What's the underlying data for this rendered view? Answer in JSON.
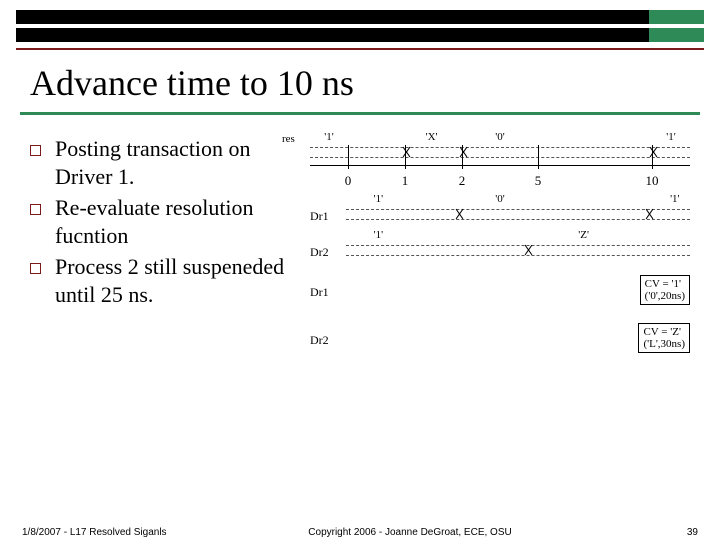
{
  "title": "Advance time to 10 ns",
  "bullets": [
    "Posting transaction on Driver 1.",
    "Re-evaluate resolution fucntion",
    "Process 2 still suspeneded until 25 ns."
  ],
  "timeline": {
    "row_label": "res",
    "ticks": [
      "0",
      "1",
      "2",
      "5",
      "10"
    ],
    "values": [
      "'1'",
      "'X'",
      "'0'",
      "'1'"
    ]
  },
  "drivers": {
    "dr1": {
      "label": "Dr1",
      "values": [
        "'1'",
        "'0'",
        "'1'"
      ]
    },
    "dr2": {
      "label": "Dr2",
      "values": [
        "'1'",
        "'Z'"
      ]
    }
  },
  "cv": {
    "dr1": {
      "label": "Dr1",
      "cv_top": "CV = '1'",
      "cv_bot": "('0',20ns)"
    },
    "dr2": {
      "label": "Dr2",
      "cv_top": "CV = 'Z'",
      "cv_bot": "('L',30ns)"
    }
  },
  "footer": {
    "left": "1/8/2007 - L17 Resolved Siganls",
    "center": "Copyright 2006 - Joanne DeGroat, ECE, OSU",
    "right": "39"
  }
}
